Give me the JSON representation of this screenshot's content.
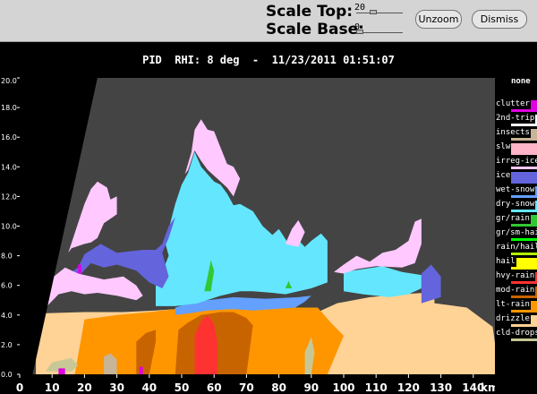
{
  "toolbar": {
    "scale_top_label": "Scale Top:",
    "scale_top_value": "20",
    "scale_top_level": 0.34,
    "scale_base_label": "Scale Base:",
    "scale_base_value": "0",
    "scale_base_level": 0.0,
    "unzoom_label": "Unzoom",
    "dismiss_label": "Dismiss"
  },
  "title": "PID  RHI: 8 deg  -  11/23/2011 01:51:07",
  "legend": {
    "top_label": "none",
    "items": [
      {
        "label": "clutter",
        "color": "#e100e1"
      },
      {
        "label": "2nd-trip",
        "color": "#ffffff"
      },
      {
        "label": "insects",
        "color": "#c8b496"
      },
      {
        "label": "slw",
        "color": "#ffb4c8"
      },
      {
        "label": "irreg-ice",
        "color": "#ffc8ff"
      },
      {
        "label": "ice",
        "color": "#6464dc"
      },
      {
        "label": "wet-snow",
        "color": "#64a0ff"
      },
      {
        "label": "dry-snow",
        "color": "#64e6ff"
      },
      {
        "label": "gr/rain",
        "color": "#32c832"
      },
      {
        "label": "gr/sm-hail",
        "color": "#00ff00"
      },
      {
        "label": "rain/hail",
        "color": "#b4f000"
      },
      {
        "label": "hail",
        "color": "#ffff00"
      },
      {
        "label": "hvy-rain",
        "color": "#ff3232"
      },
      {
        "label": "mod-rain",
        "color": "#c86400"
      },
      {
        "label": "lt-rain",
        "color": "#ff9600"
      },
      {
        "label": "drizzle",
        "color": "#ffd296"
      },
      {
        "label": "cld-drops",
        "color": "#c8c896"
      }
    ]
  },
  "chart_data": {
    "type": "heatmap",
    "title": "PID  RHI: 8 deg  -  11/23/2011 01:51:07",
    "xlabel": "km",
    "ylabel": "",
    "xlim": [
      0,
      150
    ],
    "ylim": [
      0,
      20
    ],
    "x_ticks": [
      0,
      10,
      20,
      30,
      40,
      50,
      60,
      70,
      80,
      90,
      100,
      110,
      120,
      130,
      140
    ],
    "y_ticks": [
      "0.0",
      "2.0",
      "4.0",
      "6.0",
      "8.0",
      "10.0",
      "12.0",
      "14.0",
      "16.0",
      "18.0",
      "20.0"
    ],
    "background_color": "#444444",
    "regions": [
      {
        "class": "drizzle",
        "points": [
          [
            5,
            0
          ],
          [
            5,
            4.1
          ],
          [
            20,
            4.2
          ],
          [
            32,
            4.2
          ],
          [
            42,
            4.3
          ],
          [
            55,
            4.5
          ],
          [
            60,
            4.4
          ],
          [
            68,
            4.6
          ],
          [
            78,
            4.3
          ],
          [
            85,
            4.3
          ],
          [
            92,
            4.2
          ],
          [
            98,
            4.8
          ],
          [
            108,
            5.2
          ],
          [
            118,
            5.4
          ],
          [
            125,
            5.5
          ],
          [
            128,
            5.3
          ],
          [
            128,
            4.8
          ],
          [
            138,
            4.5
          ],
          [
            146,
            3.2
          ],
          [
            148,
            0
          ]
        ]
      },
      {
        "class": "lt-rain",
        "points": [
          [
            17,
            0
          ],
          [
            20,
            3.7
          ],
          [
            30,
            4.0
          ],
          [
            40,
            4.2
          ],
          [
            48,
            4.4
          ],
          [
            58,
            4.6
          ],
          [
            66,
            4.8
          ],
          [
            75,
            4.4
          ],
          [
            85,
            4.5
          ],
          [
            92,
            4.5
          ],
          [
            96,
            3.5
          ],
          [
            100,
            2.6
          ],
          [
            95,
            0
          ]
        ]
      },
      {
        "class": "mod-rain",
        "points": [
          [
            48,
            0
          ],
          [
            49,
            3.0
          ],
          [
            52,
            3.5
          ],
          [
            56,
            4.0
          ],
          [
            62,
            4.2
          ],
          [
            66,
            4.2
          ],
          [
            70,
            3.8
          ],
          [
            72,
            3.3
          ],
          [
            70,
            0
          ]
        ]
      },
      {
        "class": "mod-rain",
        "points": [
          [
            36,
            0
          ],
          [
            36,
            2.2
          ],
          [
            39,
            2.8
          ],
          [
            42,
            3.0
          ],
          [
            42,
            2.2
          ],
          [
            40,
            0
          ]
        ]
      },
      {
        "class": "hvy-rain",
        "points": [
          [
            54,
            0
          ],
          [
            54,
            2.6
          ],
          [
            56,
            3.6
          ],
          [
            58,
            4.0
          ],
          [
            60,
            3.4
          ],
          [
            61,
            2.2
          ],
          [
            61,
            0
          ]
        ]
      },
      {
        "class": "wet-snow",
        "points": [
          [
            48,
            4.0
          ],
          [
            52,
            4.1
          ],
          [
            58,
            4.3
          ],
          [
            66,
            4.4
          ],
          [
            72,
            4.3
          ],
          [
            78,
            4.4
          ],
          [
            85,
            4.5
          ],
          [
            88,
            4.9
          ],
          [
            90,
            5.3
          ],
          [
            86,
            5.2
          ],
          [
            76,
            5.1
          ],
          [
            66,
            5.2
          ],
          [
            58,
            5.0
          ],
          [
            52,
            4.8
          ],
          [
            48,
            4.5
          ]
        ]
      },
      {
        "class": "dry-snow",
        "points": [
          [
            42,
            4.6
          ],
          [
            48,
            4.6
          ],
          [
            55,
            4.8
          ],
          [
            62,
            5.3
          ],
          [
            68,
            5.6
          ],
          [
            72,
            5.6
          ],
          [
            78,
            5.5
          ],
          [
            82,
            5.4
          ],
          [
            86,
            5.6
          ],
          [
            90,
            5.8
          ],
          [
            95,
            6.2
          ],
          [
            95,
            9.0
          ],
          [
            93,
            9.5
          ],
          [
            90,
            9.0
          ],
          [
            88,
            8.6
          ],
          [
            85,
            9.3
          ],
          [
            83,
            8.8
          ],
          [
            80,
            9.8
          ],
          [
            78,
            9.4
          ],
          [
            75,
            10.0
          ],
          [
            72,
            11.0
          ],
          [
            68,
            11.5
          ],
          [
            66,
            11.4
          ],
          [
            64,
            12.2
          ],
          [
            62,
            12.8
          ],
          [
            60,
            13.0
          ],
          [
            58,
            13.5
          ],
          [
            56,
            14.0
          ],
          [
            54,
            15.0
          ],
          [
            52,
            13.6
          ],
          [
            50,
            12.8
          ],
          [
            48,
            11.5
          ],
          [
            46,
            9.8
          ],
          [
            45,
            8.8
          ],
          [
            46,
            8.0
          ],
          [
            44,
            6.9
          ],
          [
            42,
            6.5
          ]
        ]
      },
      {
        "class": "dry-snow",
        "points": [
          [
            100,
            5.6
          ],
          [
            106,
            5.4
          ],
          [
            114,
            5.2
          ],
          [
            120,
            5.4
          ],
          [
            124,
            5.8
          ],
          [
            124,
            6.7
          ],
          [
            118,
            6.9
          ],
          [
            112,
            7.3
          ],
          [
            106,
            7.1
          ],
          [
            100,
            6.9
          ]
        ]
      },
      {
        "class": "ice",
        "points": [
          [
            16,
            6.1
          ],
          [
            22,
            7.5
          ],
          [
            26,
            7.2
          ],
          [
            30,
            7.4
          ],
          [
            36,
            7.0
          ],
          [
            40,
            6.2
          ],
          [
            44,
            5.8
          ],
          [
            46,
            6.6
          ],
          [
            44,
            8.2
          ],
          [
            46,
            9.2
          ],
          [
            48,
            10.6
          ],
          [
            46,
            10.0
          ],
          [
            44,
            8.8
          ],
          [
            42,
            8.4
          ],
          [
            38,
            8.4
          ],
          [
            30,
            8.2
          ],
          [
            25,
            8.8
          ],
          [
            20,
            8.1
          ],
          [
            18,
            7.2
          ],
          [
            14,
            6.6
          ]
        ]
      },
      {
        "class": "ice",
        "points": [
          [
            124,
            4.8
          ],
          [
            130,
            5.2
          ],
          [
            130,
            6.6
          ],
          [
            127,
            7.4
          ],
          [
            124,
            6.8
          ]
        ]
      },
      {
        "class": "irreg-ice",
        "points": [
          [
            15,
            8.2
          ],
          [
            18,
            10.2
          ],
          [
            20,
            11.5
          ],
          [
            22,
            12.5
          ],
          [
            24,
            13.0
          ],
          [
            27,
            12.6
          ],
          [
            28,
            11.8
          ],
          [
            30,
            12.0
          ],
          [
            30,
            10.8
          ],
          [
            26,
            10.2
          ],
          [
            24,
            9.2
          ],
          [
            22,
            8.9
          ],
          [
            20,
            8.8
          ],
          [
            16,
            8.5
          ]
        ]
      },
      {
        "class": "irreg-ice",
        "points": [
          [
            8,
            4.5
          ],
          [
            12,
            5.4
          ],
          [
            16,
            5.6
          ],
          [
            20,
            5.4
          ],
          [
            24,
            5.5
          ],
          [
            30,
            5.3
          ],
          [
            36,
            5.0
          ],
          [
            38,
            5.3
          ],
          [
            36,
            6.0
          ],
          [
            32,
            6.6
          ],
          [
            26,
            6.4
          ],
          [
            22,
            6.6
          ],
          [
            18,
            6.8
          ],
          [
            14,
            7.2
          ],
          [
            10,
            6.5
          ],
          [
            8,
            5.5
          ]
        ]
      },
      {
        "class": "irreg-ice",
        "points": [
          [
            51,
            13.5
          ],
          [
            53,
            15.0
          ],
          [
            54,
            16.5
          ],
          [
            56,
            17.2
          ],
          [
            58,
            16.5
          ],
          [
            60,
            16.4
          ],
          [
            62,
            15.3
          ],
          [
            64,
            14.2
          ],
          [
            66,
            14.0
          ],
          [
            68,
            13.2
          ],
          [
            66,
            12.0
          ],
          [
            64,
            12.6
          ],
          [
            62,
            13.0
          ],
          [
            60,
            13.4
          ],
          [
            58,
            13.8
          ],
          [
            56,
            14.4
          ],
          [
            54,
            15.1
          ],
          [
            52,
            13.8
          ]
        ]
      },
      {
        "class": "irreg-ice",
        "points": [
          [
            82,
            8.8
          ],
          [
            84,
            9.8
          ],
          [
            86,
            10.4
          ],
          [
            88,
            9.6
          ],
          [
            86,
            8.6
          ]
        ]
      },
      {
        "class": "irreg-ice",
        "points": [
          [
            97,
            6.9
          ],
          [
            100,
            7.4
          ],
          [
            104,
            8.0
          ],
          [
            108,
            7.6
          ],
          [
            112,
            8.2
          ],
          [
            116,
            8.4
          ],
          [
            120,
            9.0
          ],
          [
            122,
            10.3
          ],
          [
            124,
            10.5
          ],
          [
            124,
            8.8
          ],
          [
            122,
            7.5
          ],
          [
            118,
            7.2
          ],
          [
            110,
            7.3
          ],
          [
            104,
            7.1
          ],
          [
            100,
            6.8
          ]
        ]
      },
      {
        "class": "gr/rain",
        "points": [
          [
            57,
            5.6
          ],
          [
            58,
            6.6
          ],
          [
            59,
            7.7
          ],
          [
            60,
            7.0
          ],
          [
            59,
            5.6
          ]
        ]
      },
      {
        "class": "gr/rain",
        "points": [
          [
            82,
            5.8
          ],
          [
            83,
            6.3
          ],
          [
            84,
            5.8
          ]
        ]
      },
      {
        "class": "cld-drops",
        "points": [
          [
            8,
            0.2
          ],
          [
            10,
            0.8
          ],
          [
            16,
            1.1
          ],
          [
            18,
            0.6
          ],
          [
            16,
            0.2
          ]
        ]
      },
      {
        "class": "cld-drops",
        "points": [
          [
            88,
            0
          ],
          [
            88,
            1.5
          ],
          [
            90,
            2.5
          ],
          [
            91,
            1.5
          ],
          [
            90,
            0
          ]
        ]
      },
      {
        "class": "insects",
        "points": [
          [
            26,
            0
          ],
          [
            26,
            1.2
          ],
          [
            28,
            1.4
          ],
          [
            30,
            1.0
          ],
          [
            30,
            0
          ]
        ]
      },
      {
        "class": "clutter",
        "points": [
          [
            12,
            0
          ],
          [
            12,
            0.4
          ],
          [
            14,
            0.4
          ],
          [
            14,
            0
          ]
        ]
      },
      {
        "class": "clutter",
        "points": [
          [
            18,
            6.8
          ],
          [
            18,
            7.4
          ],
          [
            19,
            7.4
          ],
          [
            19,
            6.8
          ]
        ]
      },
      {
        "class": "clutter",
        "points": [
          [
            37,
            0
          ],
          [
            37,
            0.5
          ],
          [
            38,
            0.5
          ],
          [
            38,
            0
          ]
        ]
      }
    ]
  }
}
